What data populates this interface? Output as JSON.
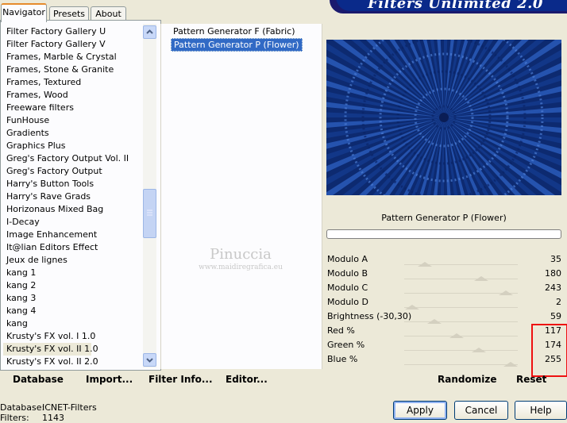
{
  "tabs": [
    {
      "label": "Navigator",
      "active": true
    },
    {
      "label": "Presets",
      "active": false
    },
    {
      "label": "About",
      "active": false
    }
  ],
  "header": {
    "title": "Filters Unlimited 2.0"
  },
  "categories": [
    "Filter Factory Gallery U",
    "Filter Factory Gallery V",
    "Frames, Marble & Crystal",
    "Frames, Stone & Granite",
    "Frames, Textured",
    "Frames, Wood",
    "Freeware filters",
    "FunHouse",
    "Gradients",
    "Graphics Plus",
    "Greg's Factory Output Vol. II",
    "Greg's Factory Output",
    "Harry's Button Tools",
    "Harry's Rave Grads",
    "Horizonaus Mixed Bag",
    "I-Decay",
    "Image Enhancement",
    "It@lian Editors Effect",
    "Jeux de lignes",
    "kang 1",
    "kang 2",
    "kang 3",
    "kang 4",
    "kang",
    "Krusty's FX vol. I 1.0",
    "Krusty's FX vol. II 1.0",
    "Krusty's FX vol. II 2.0"
  ],
  "selected_category": "Krusty's FX vol. II 1.0",
  "filters": [
    {
      "label": "Pattern Generator F (Fabric)",
      "selected": false
    },
    {
      "label": "Pattern Generator P (Flower)",
      "selected": true
    }
  ],
  "watermark": {
    "name": "Pinuccia",
    "url": "www.maidiregrafica.eu"
  },
  "preview": {
    "filter_name": "Pattern Generator P (Flower)"
  },
  "params": [
    {
      "label": "Modulo A",
      "value": "35",
      "level": 35
    },
    {
      "label": "Modulo B",
      "value": "180",
      "level": 180
    },
    {
      "label": "Modulo C",
      "value": "243",
      "level": 243
    },
    {
      "label": "Modulo D",
      "value": "2",
      "level": 2
    },
    {
      "label": "Brightness (-30,30)",
      "value": "59",
      "level": 59
    },
    {
      "label": "Red %",
      "value": "117",
      "level": 117
    },
    {
      "label": "Green %",
      "value": "174",
      "level": 174
    },
    {
      "label": "Blue %",
      "value": "255",
      "level": 255
    }
  ],
  "actions": {
    "database": "Database",
    "import": "Import...",
    "filter_info": "Filter Info...",
    "editor": "Editor...",
    "randomize": "Randomize",
    "reset": "Reset"
  },
  "buttons": {
    "apply": "Apply",
    "cancel": "Cancel",
    "help": "Help"
  },
  "status": {
    "database_label": "Database:",
    "database_value": "ICNET-Filters",
    "filters_label": "Filters:",
    "filters_value": "1143"
  },
  "colors": {
    "accent": "#316ac5",
    "preview_bg": "#0d2a70",
    "highlight_border": "#ee1111"
  }
}
